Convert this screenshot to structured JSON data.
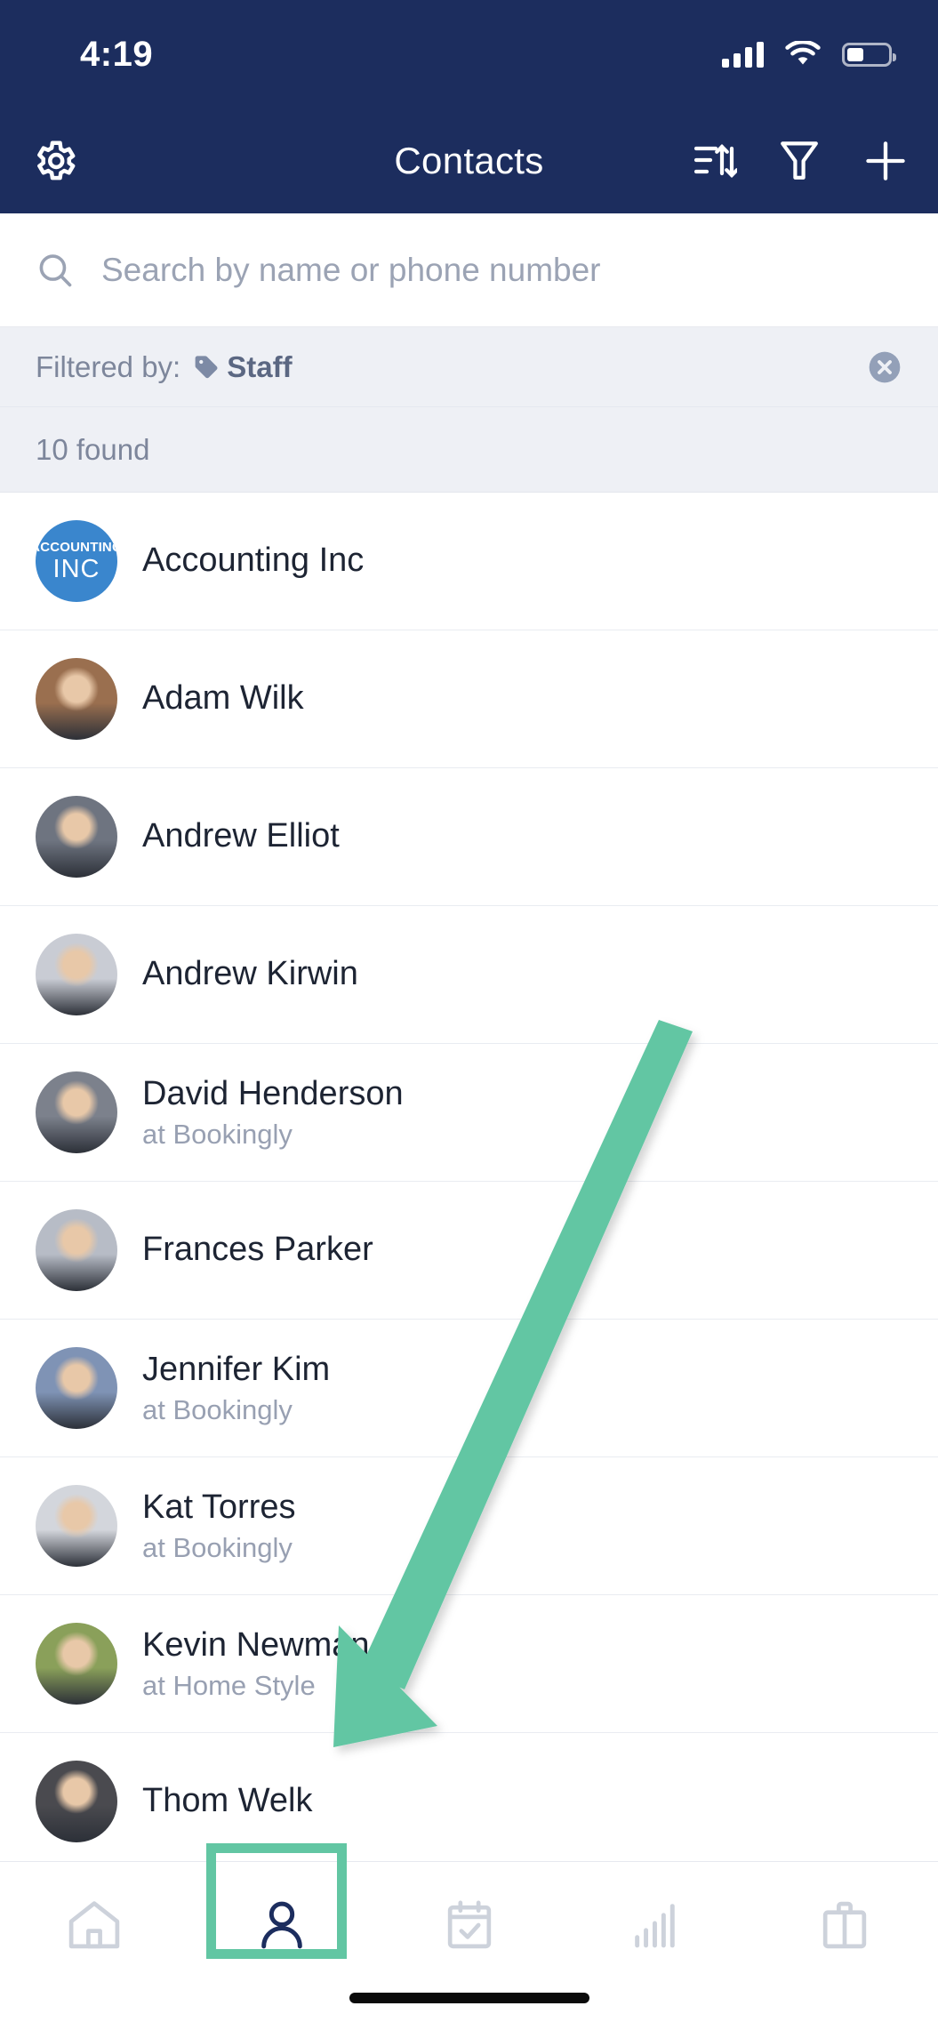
{
  "status_bar": {
    "time": "4:19",
    "signal_icon": "cellular-signal-icon",
    "wifi_icon": "wifi-icon",
    "battery_icon": "battery-icon",
    "battery_level_pct": 42
  },
  "nav_bar": {
    "settings_icon": "gear-icon",
    "title": "Contacts",
    "sort_icon": "sort-icon",
    "filter_icon": "funnel-filter-icon",
    "add_icon": "plus-icon"
  },
  "search": {
    "icon": "search-icon",
    "placeholder": "Search by name or phone number",
    "value": ""
  },
  "filter_banner": {
    "label": "Filtered by:",
    "tag_icon": "tag-icon",
    "tag_value": "Staff",
    "clear_icon": "clear-circle-x-icon",
    "result_count": "10 found"
  },
  "contacts": [
    {
      "name": "Accounting Inc",
      "subtitle": "",
      "avatar_type": "initials",
      "avatar_line1": "ACCOUNTING",
      "avatar_line2": "INC",
      "avatar_color": "#3a86cd"
    },
    {
      "name": "Adam Wilk",
      "subtitle": "",
      "avatar_type": "photo",
      "avatar_color": "#9a6f4f"
    },
    {
      "name": "Andrew Elliot",
      "subtitle": "",
      "avatar_type": "photo",
      "avatar_color": "#6e7480"
    },
    {
      "name": "Andrew Kirwin",
      "subtitle": "",
      "avatar_type": "photo",
      "avatar_color": "#c9ccd4"
    },
    {
      "name": "David Henderson",
      "subtitle": "at Bookingly",
      "avatar_type": "photo",
      "avatar_color": "#7c818c"
    },
    {
      "name": "Frances Parker",
      "subtitle": "",
      "avatar_type": "photo",
      "avatar_color": "#b7bcc6"
    },
    {
      "name": "Jennifer Kim",
      "subtitle": "at Bookingly",
      "avatar_type": "photo",
      "avatar_color": "#7f93b5"
    },
    {
      "name": "Kat Torres",
      "subtitle": "at Bookingly",
      "avatar_type": "photo",
      "avatar_color": "#d3d6dc"
    },
    {
      "name": "Kevin Newman",
      "subtitle": "at Home Style",
      "avatar_type": "photo",
      "avatar_color": "#8aa05a"
    },
    {
      "name": "Thom Welk",
      "subtitle": "",
      "avatar_type": "photo",
      "avatar_color": "#4a4a4f"
    }
  ],
  "tab_bar": {
    "items": [
      {
        "icon": "home-icon",
        "active": false
      },
      {
        "icon": "person-icon",
        "active": true
      },
      {
        "icon": "calendar-check-icon",
        "active": false
      },
      {
        "icon": "bar-chart-icon",
        "active": false
      },
      {
        "icon": "briefcase-icon",
        "active": false
      }
    ]
  },
  "annotation": {
    "arrow_icon": "pointer-arrow-annotation",
    "highlight_icon": "highlight-box-annotation",
    "color": "#62c6a3"
  },
  "colors": {
    "navy": "#1c2d5e",
    "accent_teal": "#62c6a3",
    "banner_gray": "#eef0f5",
    "text_primary": "#1d2433",
    "text_muted": "#98a0b2"
  }
}
